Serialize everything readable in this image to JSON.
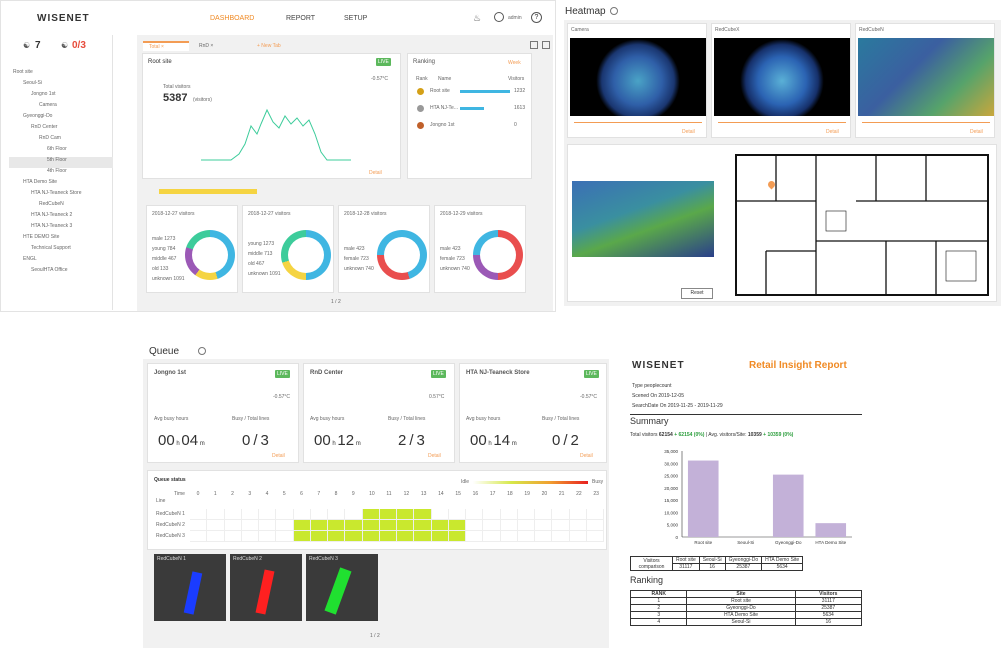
{
  "dashboard": {
    "logo": "WISENET",
    "nav": [
      "DASHBOARD",
      "REPORT",
      "SETUP"
    ],
    "user": "admin",
    "counts": {
      "sites": "7",
      "alerts": "0/3"
    },
    "tabs": [
      "Total",
      "RnD",
      "+ New Tab"
    ],
    "tree": [
      "Root site",
      "Seoul-Si",
      "Jongno 1st",
      "Camera",
      "Gyeonggi-Do",
      "RnD Center",
      "RnD Cam",
      "6th Floor",
      "5th Floor",
      "4th Floor",
      "HTA Demo Site",
      "HTA NJ-Teaneck Store",
      "RedCubeN",
      "HTA NJ-Teaneck 2",
      "HTA NJ-Teaneck 3",
      "HTE DEMO Site",
      "Technical Support",
      "ENGL",
      "SeoulHTA Office"
    ],
    "root": {
      "title": "Root site",
      "total_label": "Total visitors",
      "total": "5387",
      "unit": "(visitors)",
      "temp": "-0.57°C",
      "detail": "Detail"
    },
    "ranking": {
      "title": "Ranking",
      "filter": "Week",
      "cols": [
        "Rank",
        "Name",
        "Visitors"
      ],
      "rows": [
        {
          "name": "Root site",
          "val": "1232"
        },
        {
          "name": "HTA NJ-Te...",
          "val": "1613"
        },
        {
          "name": "Jongno 1st",
          "val": "0"
        }
      ]
    },
    "donuts": [
      {
        "title": "2018-12-27 visitors",
        "items": [
          "male 1273",
          "young 784",
          "middle 467",
          "old 133",
          "unknown 1091"
        ]
      },
      {
        "title": "2018-12-27 visitors",
        "items": [
          "young 1273",
          "middle 713",
          "old 467",
          "unknown 1091"
        ]
      },
      {
        "title": "2018-12-28 visitors",
        "items": [
          "male 423",
          "female 723",
          "unknown 740"
        ]
      },
      {
        "title": "2018-12-29 visitors",
        "items": [
          "male 423",
          "female 723",
          "unknown 740"
        ]
      }
    ],
    "pager": "1 / 2"
  },
  "heatmap": {
    "title": "Heatmap",
    "cams": [
      {
        "name": "Camera",
        "detail": "Detail"
      },
      {
        "name": "RedCubeX",
        "detail": "Detail"
      },
      {
        "name": "RedCubeN",
        "detail": "Detail"
      }
    ],
    "reset": "Reset"
  },
  "queue": {
    "title": "Queue",
    "sites": [
      {
        "name": "Jongno 1st",
        "temp": "-0.57°C",
        "busy_label": "Avg busy hours",
        "busy_h": "00",
        "busy_m": "04",
        "ratio_label": "Busy / Total lines",
        "ratio": "0/3",
        "detail": "Detail"
      },
      {
        "name": "RnD Center",
        "temp": "0.57°C",
        "busy_label": "Avg busy hours",
        "busy_h": "00",
        "busy_m": "12",
        "ratio_label": "Busy / Total lines",
        "ratio": "2/3",
        "detail": "Detail"
      },
      {
        "name": "HTA NJ-Teaneck Store",
        "temp": "-0.57°C",
        "busy_label": "Avg busy hours",
        "busy_h": "00",
        "busy_m": "14",
        "ratio_label": "Busy / Total lines",
        "ratio": "0/2",
        "detail": "Detail"
      }
    ],
    "live": "LIVE",
    "status_title": "Queue status",
    "idle": "Idle",
    "busy": "Busy",
    "hours": [
      "0",
      "1",
      "2",
      "3",
      "4",
      "5",
      "6",
      "7",
      "8",
      "9",
      "10",
      "11",
      "12",
      "13",
      "14",
      "15",
      "16",
      "17",
      "18",
      "19",
      "20",
      "21",
      "22",
      "23"
    ],
    "rows": [
      "RedCubeN 1",
      "RedCubeN 2",
      "RedCubeN 3"
    ],
    "row_head": [
      "Time",
      "Line"
    ],
    "thumbs": [
      "RedCubeN 1",
      "RedCubeN 2",
      "RedCubeN 3"
    ],
    "pager": "1 / 2"
  },
  "report": {
    "logo": "WISENET",
    "title": "Retail Insight Report",
    "type": "Type   peoplecount",
    "created": "Scened On  2019-12-05",
    "range": "SearchDate On  2019-11-25 - 2019-11-29",
    "summary": "Summary",
    "total_prefix": "Total visitors",
    "total_val": "62154",
    "total_delta": "+ 62154 (0%)",
    "avg_prefix": "Avg. visitors/Site:",
    "avg_val": "10359",
    "avg_delta": "+ 10359 (0%)",
    "table_head": "Visitors comparison",
    "ranking_title": "Ranking",
    "rank_cols": [
      "RANK",
      "Site",
      "Visitors"
    ],
    "ranks": [
      [
        "1",
        "Root site",
        "31117"
      ],
      [
        "2",
        "Gyeonggi-Do",
        "25387"
      ],
      [
        "3",
        "HTA Demo Site",
        "5634"
      ],
      [
        "4",
        "Seoul-Si",
        "16"
      ]
    ]
  },
  "chart_data": {
    "type": "bar",
    "categories": [
      "Root site",
      "Seoul-Si",
      "Gyeonggi-Do",
      "HTA Demo Site"
    ],
    "values": [
      31117,
      16,
      25387,
      5634
    ],
    "ylim": [
      0,
      35000
    ],
    "yticks": [
      "35,000",
      "30,000",
      "25,000",
      "20,000",
      "15,000",
      "10,000",
      "5,000",
      "0"
    ],
    "color": "#c3b1d8"
  }
}
